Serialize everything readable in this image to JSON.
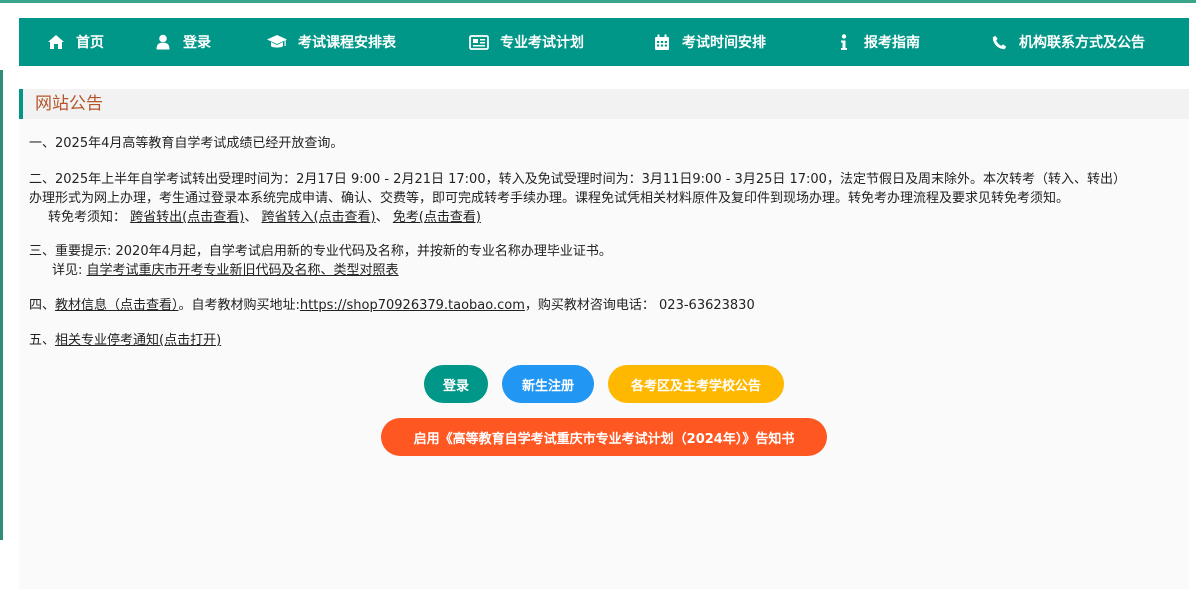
{
  "colors": {
    "nav_bg": "#009688",
    "title_color": "#b5552a",
    "btn_login": "#009688",
    "btn_register": "#2196f3",
    "btn_exam_areas": "#ffb800",
    "btn_plan_notice": "#ff5722"
  },
  "nav": {
    "items": [
      {
        "label": "首页",
        "icon": "home-icon"
      },
      {
        "label": "登录",
        "icon": "user-icon"
      },
      {
        "label": "考试课程安排表",
        "icon": "graduation-cap-icon"
      },
      {
        "label": "专业考试计划",
        "icon": "newspaper-icon"
      },
      {
        "label": "考试时间安排",
        "icon": "calendar-icon"
      },
      {
        "label": "报考指南",
        "icon": "info-icon"
      },
      {
        "label": "机构联系方式及公告",
        "icon": "phone-icon"
      }
    ]
  },
  "notice": {
    "title": "网站公告",
    "p1": "一、2025年4月高等教育自学考试成绩已经开放查询。",
    "p2_line1": "二、2025年上半年自学考试转出受理时间为：2月17日 9:00 - 2月21日 17:00，转入及免试受理时间为：3月11日9:00 - 3月25日 17:00，法定节假日及周末除外。本次转考（转入、转出）",
    "p2_line2": "办理形式为网上办理，考生通过登录本系统完成申请、确认、交费等，即可完成转考手续办理。课程免试凭相关材料原件及复印件到现场办理。转免考办理流程及要求见转免考须知。",
    "p2_line3_prefix": "转免考须知：",
    "p2_link1": "跨省转出(点击查看)",
    "p2_sep1": "、",
    "p2_link2": "跨省转入(点击查看)",
    "p2_sep2": "、",
    "p2_link3": "免考(点击查看)",
    "p3_line1": "三、重要提示: 2020年4月起，自学考试启用新的专业代码及名称，并按新的专业名称办理毕业证书。",
    "p3_line2_prefix": "详见:",
    "p3_link": "自学考试重庆市开考专业新旧代码及名称、类型对照表",
    "p4_prefix": "四、",
    "p4_link": "教材信息（点击查看）",
    "p4_mid": "。自考教材购买地址:",
    "p4_url": "https://shop70926379.taobao.com",
    "p4_suffix": "，购买教材咨询电话： 023-63623830",
    "p5_prefix": "五、",
    "p5_link": "相关专业停考通知(点击打开)"
  },
  "buttons": {
    "login": "登录",
    "register": "新生注册",
    "exam_areas": "各考区及主考学校公告",
    "plan_notice": "启用《高等教育自学考试重庆市专业考试计划（2024年）》告知书"
  }
}
